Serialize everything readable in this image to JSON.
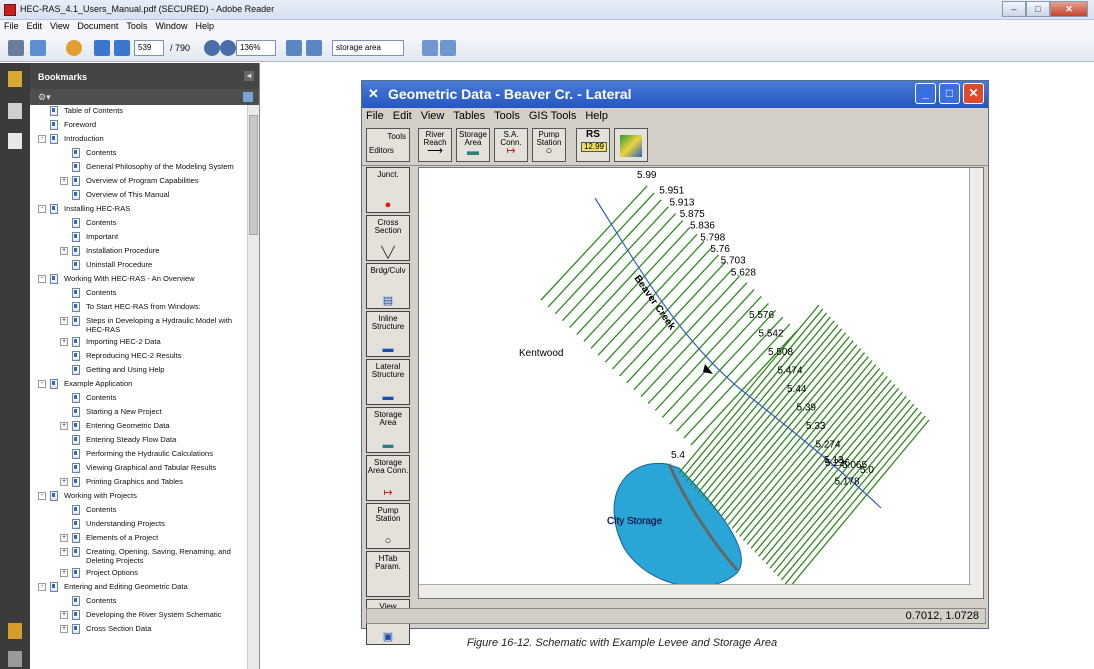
{
  "window": {
    "title": "HEC-RAS_4.1_Users_Manual.pdf (SECURED) - Adobe Reader"
  },
  "menubar": [
    "File",
    "Edit",
    "View",
    "Document",
    "Tools",
    "Window",
    "Help"
  ],
  "toolbar": {
    "page_current": "539",
    "page_total": "/ 790",
    "zoom": "136%",
    "search": "storage area"
  },
  "bookmarks": {
    "title": "Bookmarks",
    "items": [
      {
        "label": "Table of Contents",
        "level": 0
      },
      {
        "label": "Foreword",
        "level": 0
      },
      {
        "label": "Introduction",
        "level": 0,
        "expander": "-"
      },
      {
        "label": "Contents",
        "level": 1
      },
      {
        "label": "General Philosophy of the Modeling System",
        "level": 1
      },
      {
        "label": "Overview of Program Capabilities",
        "level": 1,
        "expander": "+"
      },
      {
        "label": "Overview of This Manual",
        "level": 1
      },
      {
        "label": "Installing HEC-RAS",
        "level": 0,
        "expander": "-"
      },
      {
        "label": "Contents",
        "level": 1
      },
      {
        "label": "Important",
        "level": 1
      },
      {
        "label": "Installation Procedure",
        "level": 1,
        "expander": "+"
      },
      {
        "label": "Uninstall Procedure",
        "level": 1
      },
      {
        "label": "Working With HEC-RAS - An Overview",
        "level": 0,
        "expander": "-"
      },
      {
        "label": "Contents",
        "level": 1
      },
      {
        "label": "To Start HEC-RAS from Windows:",
        "level": 1
      },
      {
        "label": "Steps in Developing a Hydraulic Model with HEC-RAS",
        "level": 1,
        "expander": "+"
      },
      {
        "label": "Importing HEC-2 Data",
        "level": 1,
        "expander": "+"
      },
      {
        "label": "Reproducing HEC-2 Results",
        "level": 1
      },
      {
        "label": "Getting and Using Help",
        "level": 1
      },
      {
        "label": "Example Application",
        "level": 0,
        "expander": "-"
      },
      {
        "label": "Contents",
        "level": 1
      },
      {
        "label": "Starting a New Project",
        "level": 1
      },
      {
        "label": "Entering Geometric Data",
        "level": 1,
        "expander": "+"
      },
      {
        "label": "Entering Steady Flow Data",
        "level": 1
      },
      {
        "label": "Performing the Hydraulic Calculations",
        "level": 1
      },
      {
        "label": "Viewing Graphical and Tabular Results",
        "level": 1
      },
      {
        "label": "Printing Graphics and Tables",
        "level": 1,
        "expander": "+"
      },
      {
        "label": "Working with Projects",
        "level": 0,
        "expander": "-"
      },
      {
        "label": "Contents",
        "level": 1
      },
      {
        "label": "Understanding Projects",
        "level": 1
      },
      {
        "label": "Elements of a Project",
        "level": 1,
        "expander": "+"
      },
      {
        "label": "Creating, Opening, Saving, Renaming, and Deleting Projects",
        "level": 1,
        "expander": "+"
      },
      {
        "label": "Project Options",
        "level": 1,
        "expander": "+"
      },
      {
        "label": "Entering and Editing Geometric Data",
        "level": 0,
        "expander": "-"
      },
      {
        "label": "Contents",
        "level": 1
      },
      {
        "label": "Developing the River System Schematic",
        "level": 1,
        "expander": "+"
      },
      {
        "label": "Cross Section Data",
        "level": 1,
        "expander": "+"
      }
    ]
  },
  "geo_window": {
    "title": "Geometric Data - Beaver Cr.  - Lateral",
    "menu": [
      "File",
      "Edit",
      "View",
      "Tables",
      "Tools",
      "GIS Tools",
      "Help"
    ],
    "tools_label": "Tools",
    "editors_label": "Editors",
    "tool_buttons": [
      {
        "label": "River Reach",
        "sym": "⟶"
      },
      {
        "label": "Storage Area",
        "sym": "▬"
      },
      {
        "label": "S.A. Conn.",
        "sym": "↦"
      },
      {
        "label": "Pump Station",
        "sym": "○"
      },
      {
        "label": "RS",
        "sym": "12.99"
      }
    ],
    "left_buttons": [
      {
        "label": "Junct.",
        "sym": "●"
      },
      {
        "label": "Cross Section",
        "sym": "╲╱"
      },
      {
        "label": "Brdg/Culv",
        "sym": "▤"
      },
      {
        "label": "Inline Structure",
        "sym": "▬"
      },
      {
        "label": "Lateral Structure",
        "sym": "▬"
      },
      {
        "label": "Storage Area",
        "sym": "▬"
      },
      {
        "label": "Storage Area Conn.",
        "sym": "↦"
      },
      {
        "label": "Pump Station",
        "sym": "○"
      },
      {
        "label": "HTab Param.",
        "sym": ""
      },
      {
        "label": "View Picture",
        "sym": "▣"
      }
    ],
    "status": "0.7012, 1.0728"
  },
  "schematic": {
    "reach_label": "Beaver Creek",
    "place_label": "Kentwood",
    "storage_label": "City Storage",
    "storage_node": "5.4",
    "stations": [
      "5.99",
      "5.951",
      "5.913",
      "5.875",
      "5.836",
      "5.798",
      "5.76",
      "5.703",
      "5.628",
      "5.576",
      "5.542",
      "5.508",
      "5.474",
      "5.44",
      "5.39",
      "5.33",
      "5.274",
      "5.226",
      "5.178",
      "5.13",
      "5.065",
      "5.0"
    ],
    "colors": {
      "xs": "#2e8b1e",
      "storage_fill": "#29a6d6",
      "river": "#3a5ec8"
    }
  },
  "caption": "Figure 16-12.  Schematic with Example Levee and Storage Area"
}
